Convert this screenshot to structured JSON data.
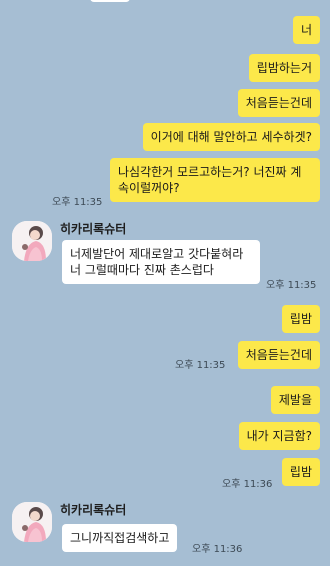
{
  "chat": {
    "messages": [
      {
        "text": "너",
        "sender": "me"
      },
      {
        "text": "립밤하는거",
        "sender": "me"
      },
      {
        "text": "처음듣는건데",
        "sender": "me"
      },
      {
        "text": "이거에 대해 말안하고 세수하겟?",
        "sender": "me"
      },
      {
        "text": "나심각한거 모르고하는거? 너진짜 계속이럴꺼야?",
        "sender": "me",
        "time": "오후 11:35"
      },
      {
        "sender_name": "히카리록슈터",
        "text": "너제발단어 제대로알고 갓다붙혀라 너 그럴때마다 진짜 촌스럽다",
        "sender": "other",
        "time": "오후 11:35"
      },
      {
        "text": "립밤",
        "sender": "me"
      },
      {
        "text": "처음듣는건데",
        "sender": "me",
        "time": "오후 11:35"
      },
      {
        "text": "제발을",
        "sender": "me"
      },
      {
        "text": "내가 지금함?",
        "sender": "me"
      },
      {
        "text": "립밤",
        "sender": "me",
        "time": "오후 11:36"
      },
      {
        "sender_name": "히카리록슈터",
        "text": "그니까직접검색하고",
        "sender": "other",
        "time": "오후 11:36"
      }
    ]
  },
  "colors": {
    "background": "#a6bed3",
    "my_bubble": "#fce84a",
    "their_bubble": "#ffffff"
  }
}
